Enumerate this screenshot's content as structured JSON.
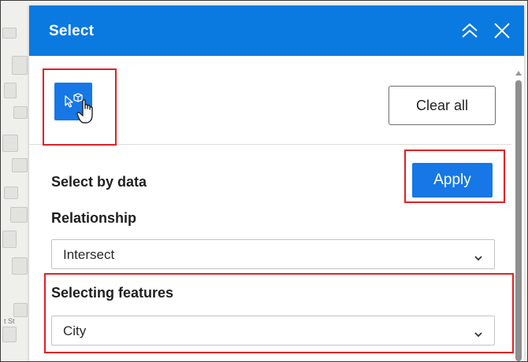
{
  "widget": {
    "title": "Select",
    "collapse_icon": "double-chevron-up-icon",
    "close_icon": "close-icon"
  },
  "toolbar": {
    "select_tool_icon": "select-by-location-icon",
    "clear_label": "Clear all"
  },
  "select_by_data": {
    "title": "Select by data",
    "apply_label": "Apply",
    "relationship": {
      "label": "Relationship",
      "value": "Intersect"
    },
    "selecting_features": {
      "label": "Selecting features",
      "value": "City"
    }
  },
  "map": {
    "street_label": "t St"
  },
  "colors": {
    "header": "#0a79e0",
    "primary_button": "#1777e6",
    "highlight": "#e21f26"
  }
}
